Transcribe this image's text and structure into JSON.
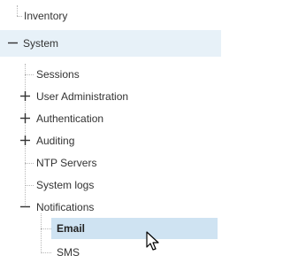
{
  "tree": {
    "root_label": "Inventory",
    "system": {
      "label": "System",
      "expanded": true,
      "children": {
        "sessions": "Sessions",
        "user_administration": "User Administration",
        "authentication": "Authentication",
        "auditing": "Auditing",
        "ntp_servers": "NTP Servers",
        "system_logs": "System logs",
        "notifications": {
          "label": "Notifications",
          "expanded": true,
          "children": {
            "email": "Email",
            "sms": "SMS"
          },
          "selected": "Email"
        }
      }
    }
  },
  "colors": {
    "highlight_band": "#e7f1f8",
    "selection": "#cfe3f2",
    "text": "#333333",
    "connector": "#b8b8b8"
  },
  "icons": {
    "collapse": "minus-icon",
    "expand": "plus-icon",
    "cursor": "mouse-pointer-icon"
  }
}
